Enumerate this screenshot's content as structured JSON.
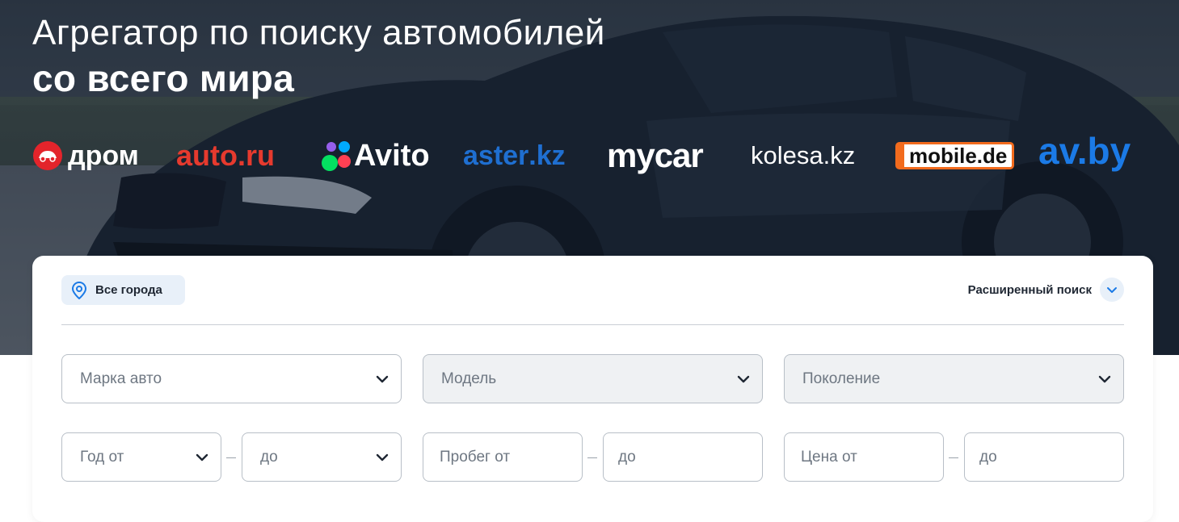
{
  "hero": {
    "title_line1": "Агрегатор по поиску автомобилей",
    "title_line2": "со всего мира"
  },
  "logos": [
    {
      "name": "дром",
      "color": "#ffffff",
      "accent": "#e3242b"
    },
    {
      "name": "auto.ru",
      "color": "#e63a2e"
    },
    {
      "name": "Avito",
      "color": "#ffffff"
    },
    {
      "name": "aster",
      "suffix": ".kz",
      "color": "#1f6fd1",
      "dot_color": "#f7c21b"
    },
    {
      "name": "mycar",
      "color": "#ffffff"
    },
    {
      "name": "kolesa.kz",
      "color": "#ffffff"
    },
    {
      "name": "mobile",
      "suffix": ".de",
      "color": "#111111",
      "accent": "#f26b1d",
      "dot_color": "#e3242b"
    },
    {
      "name": "av.by",
      "color": "#1b7ae6"
    }
  ],
  "search": {
    "city_label": "Все города",
    "advanced_label": "Расширенный поиск",
    "brand_placeholder": "Марка авто",
    "model_placeholder": "Модель",
    "generation_placeholder": "Поколение",
    "year_from_placeholder": "Год от",
    "year_to_placeholder": "до",
    "mileage_from_placeholder": "Пробег от",
    "mileage_to_placeholder": "до",
    "price_from_placeholder": "Цена от",
    "price_to_placeholder": "до"
  },
  "colors": {
    "accent_blue": "#1b7ae6",
    "chip_bg": "#e8f0f9",
    "text_dark": "#1f2733",
    "placeholder": "#6e7782"
  }
}
